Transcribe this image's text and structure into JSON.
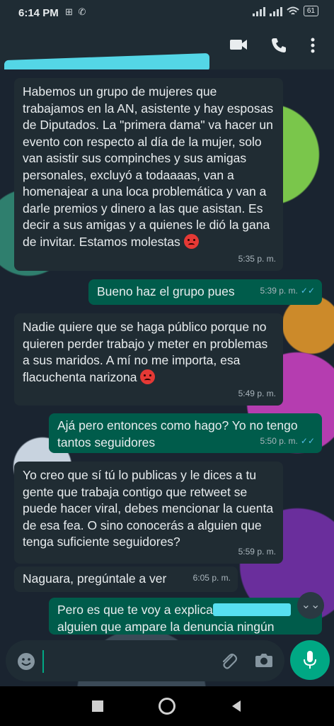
{
  "status": {
    "time": "6:14 PM",
    "battery": "61"
  },
  "header": {
    "contact_name": "",
    "video_icon": "video-camera-icon",
    "call_icon": "phone-icon",
    "menu_icon": "more-vertical-icon"
  },
  "messages": [
    {
      "dir": "in",
      "text": "Habemos un grupo de mujeres que trabajamos en la AN, asistente y hay esposas de Diputados. La \"primera dama\" va hacer un evento con respecto al día de la mujer, solo van asistir sus compinches y sus amigas personales, excluyó a todaaaas, van a homenajear a una loca problemática y van a darle premios y dinero a las que asistan. Es decir a sus amigas y a quienes le dió la gana de invitar. Estamos molestas",
      "time": "5:35 p. m."
    },
    {
      "dir": "out",
      "text": "Bueno haz el grupo pues",
      "time": "5:39 p. m."
    },
    {
      "dir": "in",
      "text": "Nadie quiere que se haga público porque no quieren perder trabajo y meter en problemas a sus maridos. A mí no me importa, esa flacuchenta narizona",
      "time": "5:49 p. m."
    },
    {
      "dir": "out",
      "text": "Ajá pero entonces como hago? Yo no tengo tantos seguidores",
      "time": "5:50 p. m."
    },
    {
      "dir": "in",
      "text": "Yo creo que sí tú lo publicas y le dices a tu gente que trabaja contigo que retweet se puede hacer viral, debes mencionar la cuenta de  esa fea. O sino conocerás a alguien que tenga suficiente seguidores?",
      "time": "5:59 p. m."
    },
    {
      "dir": "in",
      "text": "Naguara, pregúntale a ver",
      "time": "6:05 p. m."
    },
    {
      "dir": "out",
      "text_a": "Pero es que te voy a explica",
      "text_b": "alguien que ampare la denuncia ningún"
    }
  ],
  "input": {
    "placeholder": ""
  },
  "icons": {
    "emoji": "emoji-icon",
    "attach": "paperclip-icon",
    "camera": "camera-icon",
    "mic": "microphone-icon"
  },
  "colors": {
    "incoming": "#202c33",
    "outgoing": "#005c4b",
    "accent": "#00a884",
    "tick": "#53bdeb"
  }
}
